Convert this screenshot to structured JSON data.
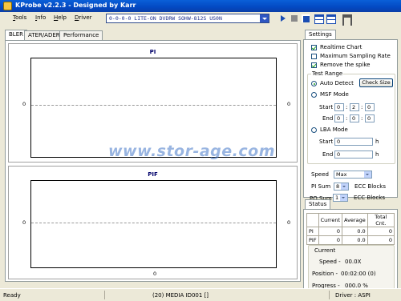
{
  "window": {
    "title": "KProbe v2.2.3 - Designed by Karr"
  },
  "menu": [
    "Tools",
    "Info",
    "Help",
    "Driver"
  ],
  "drive": {
    "selected": "0-0-0-0  LITE-ON DVDRW SOHW-812S  US0N"
  },
  "tabs": [
    "BLER",
    "ATER/ADER",
    "Performance"
  ],
  "charts": {
    "pi": {
      "title": "PI",
      "y_left": "0",
      "y_right": "0"
    },
    "pif": {
      "title": "PIF",
      "y_left": "0",
      "y_right": "0",
      "x_label": "0"
    }
  },
  "chart_data": [
    {
      "type": "line",
      "title": "PI",
      "series": [],
      "yticks_left": [
        "0"
      ],
      "yticks_right": [
        "0"
      ]
    },
    {
      "type": "line",
      "title": "PIF",
      "series": [],
      "xticks": [
        "0"
      ],
      "yticks_left": [
        "0"
      ],
      "yticks_right": [
        "0"
      ]
    }
  ],
  "watermark": "www.stor-age.com",
  "settings": {
    "tab": "Settings",
    "realtime_chart": "Realtime Chart",
    "max_sampling": "Maximum Sampling Rate",
    "remove_spike": "Remove the spike",
    "test_range": "Test Range",
    "auto_detect": "Auto Detect",
    "check_size": "Check Size",
    "msf_mode": "MSF Mode",
    "start": "Start",
    "end": "End",
    "msf_start": [
      "0",
      "2",
      "0"
    ],
    "msf_end": [
      "0",
      "0",
      "0"
    ],
    "lba_mode": "LBA Mode",
    "lba_start": "0",
    "lba_end": "0",
    "unit_h": "h",
    "speed_label": "Speed",
    "speed_value": "Max",
    "pi_sum_label": "PI Sum",
    "pi_sum_value": "8",
    "po_sum_label": "PO Sum",
    "po_sum_value": "1",
    "ecc_blocks": "ECC Blocks"
  },
  "status": {
    "tab": "Status",
    "headers": [
      "",
      "Current",
      "Average",
      "Total Cnt."
    ],
    "rows": [
      [
        "PI",
        "0",
        "0.0",
        "0"
      ],
      [
        "PIF",
        "0",
        "0.0",
        "0"
      ]
    ],
    "current_label": "Current",
    "speed_label": "Speed -",
    "speed_value": "00.0X",
    "position_label": "Position -",
    "position_value": "00:02:00 (0)",
    "progress_label": "Progress -",
    "progress_value": "000.0 %"
  },
  "statusbar": {
    "left": "Ready",
    "center": "(20) MEDIA ID001 []",
    "right": "Driver : ASPI"
  }
}
